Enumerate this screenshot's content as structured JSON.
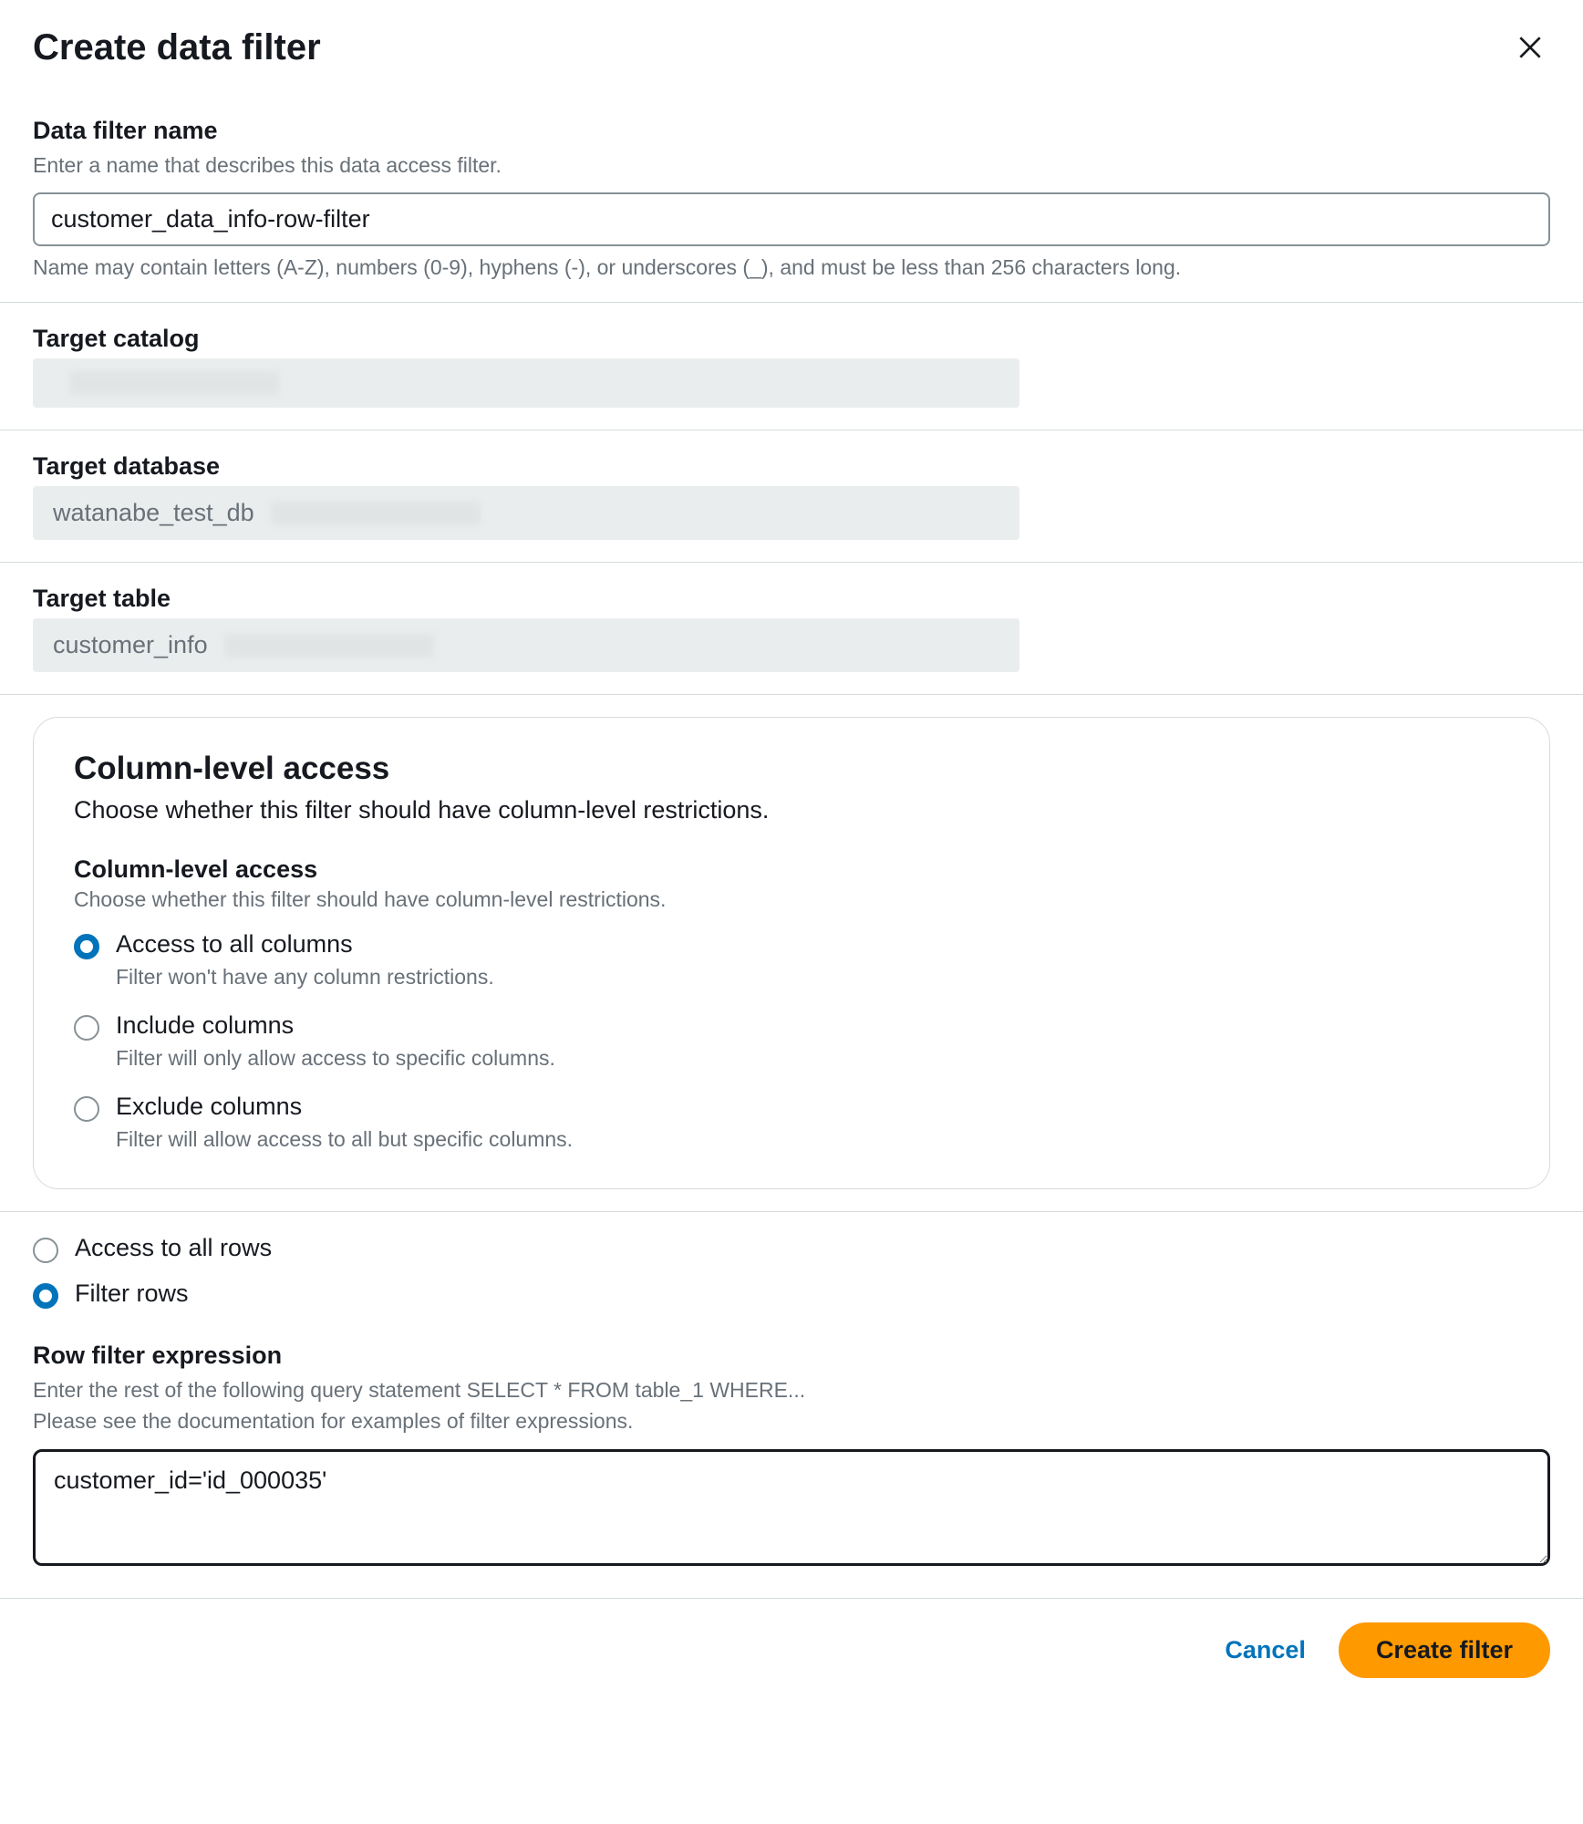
{
  "header": {
    "title": "Create data filter"
  },
  "filterName": {
    "label": "Data filter name",
    "hint": "Enter a name that describes this data access filter.",
    "value": "customer_data_info-row-filter",
    "footer": "Name may contain letters (A-Z), numbers (0-9), hyphens (-), or underscores (_), and must be less than 256 characters long."
  },
  "targetCatalog": {
    "label": "Target catalog",
    "value": ""
  },
  "targetDatabase": {
    "label": "Target database",
    "value": "watanabe_test_db"
  },
  "targetTable": {
    "label": "Target table",
    "value": "customer_info"
  },
  "columnAccess": {
    "panelTitle": "Column-level access",
    "panelSub": "Choose whether this filter should have column-level restrictions.",
    "subheader": "Column-level access",
    "subhint": "Choose whether this filter should have column-level restrictions.",
    "options": {
      "all": {
        "label": "Access to all columns",
        "desc": "Filter won't have any column restrictions."
      },
      "include": {
        "label": "Include columns",
        "desc": "Filter will only allow access to specific columns."
      },
      "exclude": {
        "label": "Exclude columns",
        "desc": "Filter will allow access to all but specific columns."
      }
    },
    "selected": "all"
  },
  "rowAccess": {
    "options": {
      "all": {
        "label": "Access to all rows"
      },
      "filter": {
        "label": "Filter rows"
      }
    },
    "selected": "filter"
  },
  "rowFilter": {
    "label": "Row filter expression",
    "hint1": "Enter the rest of the following query statement SELECT * FROM table_1 WHERE...",
    "hint2": "Please see the documentation for examples of filter expressions.",
    "value": "customer_id='id_000035'"
  },
  "footer": {
    "cancel": "Cancel",
    "create": "Create filter"
  }
}
